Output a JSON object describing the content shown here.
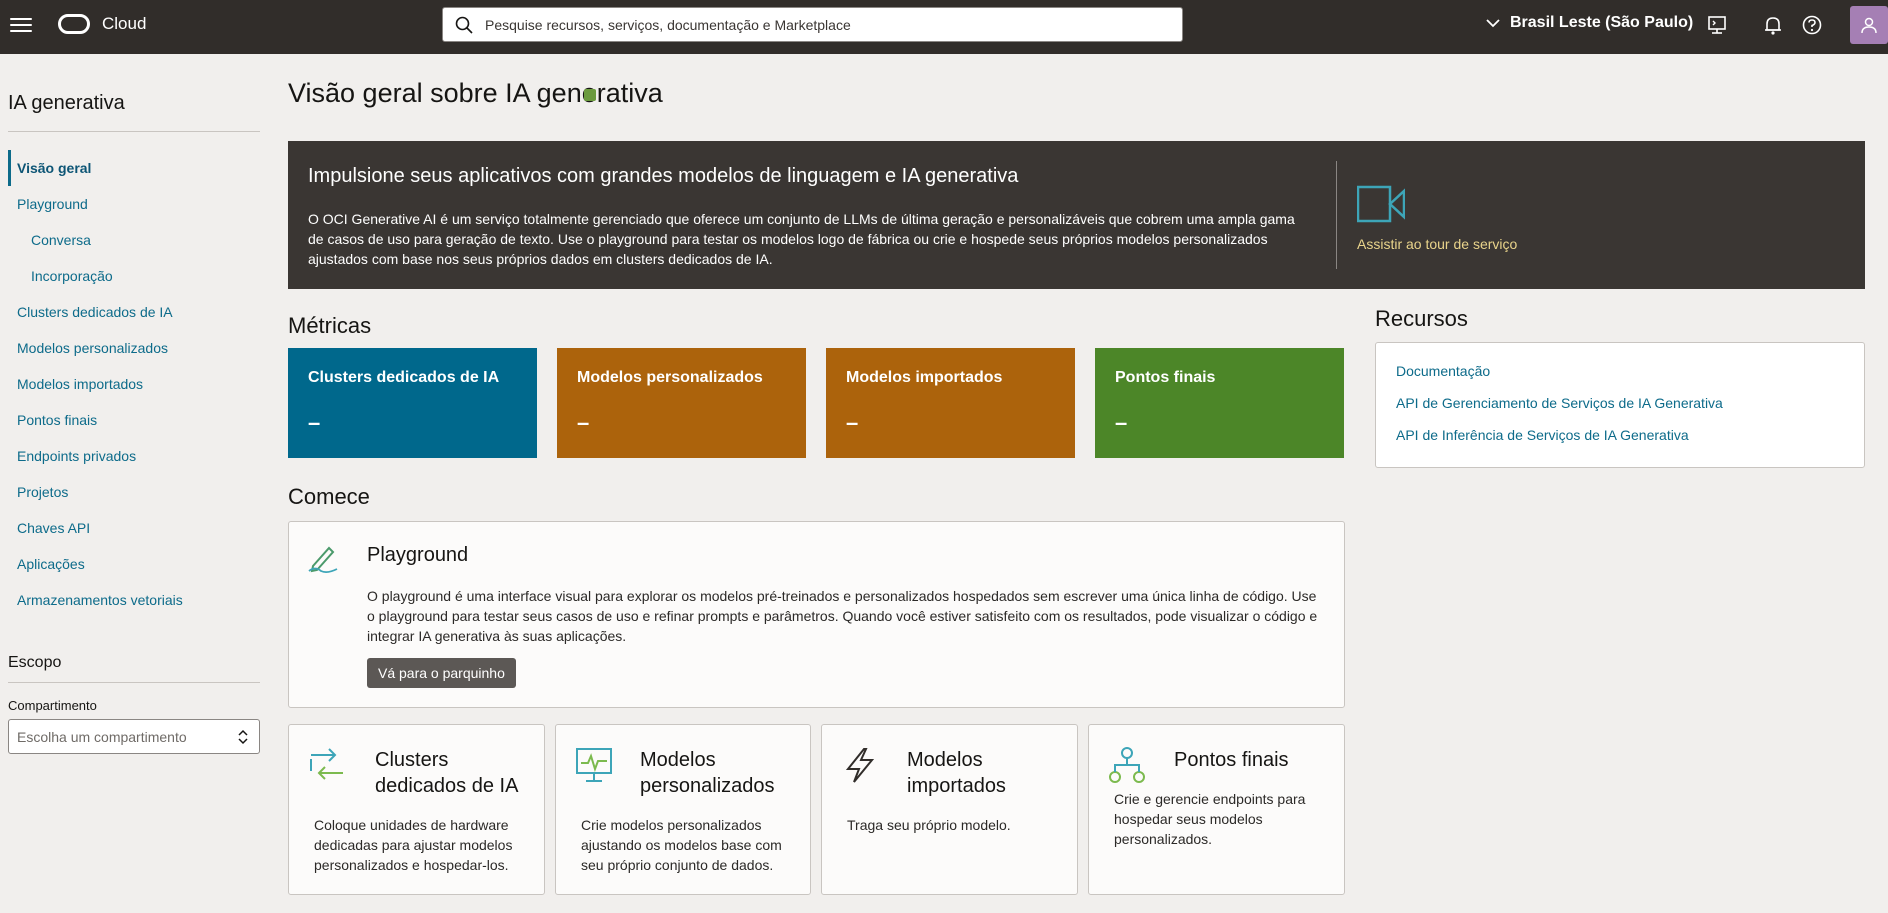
{
  "header": {
    "brand": "Cloud",
    "search_placeholder": "Pesquise recursos, serviços, documentação e Marketplace",
    "region": "Brasil Leste (São Paulo)"
  },
  "sidebar": {
    "title": "IA generativa",
    "items": [
      {
        "label": "Visão geral"
      },
      {
        "label": "Playground"
      },
      {
        "label": "Conversa"
      },
      {
        "label": "Incorporação"
      },
      {
        "label": "Clusters dedicados de IA"
      },
      {
        "label": "Modelos personalizados"
      },
      {
        "label": "Modelos importados"
      },
      {
        "label": "Pontos finais"
      },
      {
        "label": "Endpoints privados"
      },
      {
        "label": "Projetos"
      },
      {
        "label": "Chaves API"
      },
      {
        "label": "Aplicações"
      },
      {
        "label": "Armazenamentos vetoriais"
      }
    ],
    "scope_title": "Escopo",
    "compartment_label": "Compartimento",
    "compartment_placeholder": "Escolha um compartimento"
  },
  "main": {
    "title": "Visão geral sobre IA generativa",
    "hero": {
      "title": "Impulsione seus aplicativos com grandes modelos de linguagem e IA generativa",
      "description": "O OCI Generative AI é um serviço totalmente gerenciado que oferece um conjunto de LLMs de última geração e personalizáveis que cobrem uma ampla gama de casos de uso para geração de texto. Use o playground para testar os modelos logo de fábrica ou crie e hospede seus próprios modelos personalizados ajustados com base nos seus próprios dados em clusters dedicados de IA.",
      "tour_link": "Assistir ao tour de serviço"
    },
    "metrics_title": "Métricas",
    "metrics": [
      {
        "label": "Clusters dedicados de IA",
        "value": "–",
        "color": "#00688c"
      },
      {
        "label": "Modelos personalizados",
        "value": "–",
        "color": "#ac630c"
      },
      {
        "label": "Modelos importados",
        "value": "–",
        "color": "#ac630c"
      },
      {
        "label": "Pontos finais",
        "value": "–",
        "color": "#4c8628"
      }
    ],
    "resources_title": "Recursos",
    "resources": [
      {
        "label": "Documentação"
      },
      {
        "label": "API de Gerenciamento de Serviços de IA Generativa"
      },
      {
        "label": "API de Inferência de Serviços de IA Generativa"
      }
    ],
    "get_started_title": "Comece",
    "playground": {
      "title": "Playground",
      "description": "O playground é uma interface visual para explorar os modelos pré-treinados e personalizados hospedados sem escrever uma única linha de código. Use o playground para testar seus casos de uso e refinar prompts e parâmetros. Quando você estiver satisfeito com os resultados, pode visualizar o código e integrar IA generativa às suas aplicações.",
      "button": "Vá para o parquinho"
    },
    "cards": [
      {
        "title": "Clusters dedicados de IA",
        "description": "Coloque unidades de hardware dedicadas para ajustar modelos personalizados e hospedar-los.",
        "icon": "cluster-icon"
      },
      {
        "title": "Modelos personalizados",
        "description": "Crie modelos personalizados ajustando os modelos base com seu próprio conjunto de dados.",
        "icon": "monitor-icon"
      },
      {
        "title": "Modelos importados",
        "description": "Traga seu próprio modelo.",
        "icon": "lightning-icon"
      },
      {
        "title": "Pontos finais",
        "description": "Crie e gerencie endpoints para hospedar seus modelos personalizados.",
        "icon": "network-icon"
      }
    ]
  }
}
